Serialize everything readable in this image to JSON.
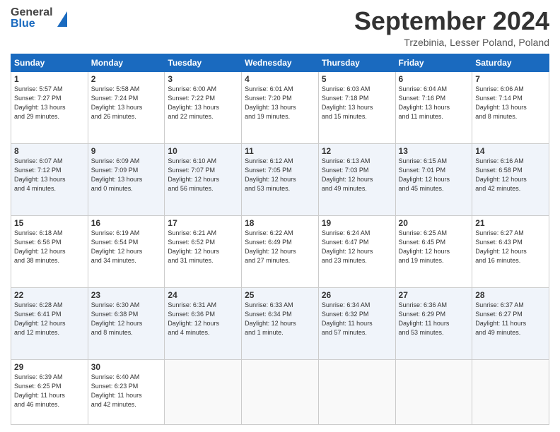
{
  "header": {
    "logo_general": "General",
    "logo_blue": "Blue",
    "month_title": "September 2024",
    "location": "Trzebinia, Lesser Poland, Poland"
  },
  "calendar": {
    "days_of_week": [
      "Sunday",
      "Monday",
      "Tuesday",
      "Wednesday",
      "Thursday",
      "Friday",
      "Saturday"
    ],
    "weeks": [
      [
        {
          "day": "1",
          "info": "Sunrise: 5:57 AM\nSunset: 7:27 PM\nDaylight: 13 hours\nand 29 minutes."
        },
        {
          "day": "2",
          "info": "Sunrise: 5:58 AM\nSunset: 7:24 PM\nDaylight: 13 hours\nand 26 minutes."
        },
        {
          "day": "3",
          "info": "Sunrise: 6:00 AM\nSunset: 7:22 PM\nDaylight: 13 hours\nand 22 minutes."
        },
        {
          "day": "4",
          "info": "Sunrise: 6:01 AM\nSunset: 7:20 PM\nDaylight: 13 hours\nand 19 minutes."
        },
        {
          "day": "5",
          "info": "Sunrise: 6:03 AM\nSunset: 7:18 PM\nDaylight: 13 hours\nand 15 minutes."
        },
        {
          "day": "6",
          "info": "Sunrise: 6:04 AM\nSunset: 7:16 PM\nDaylight: 13 hours\nand 11 minutes."
        },
        {
          "day": "7",
          "info": "Sunrise: 6:06 AM\nSunset: 7:14 PM\nDaylight: 13 hours\nand 8 minutes."
        }
      ],
      [
        {
          "day": "8",
          "info": "Sunrise: 6:07 AM\nSunset: 7:12 PM\nDaylight: 13 hours\nand 4 minutes."
        },
        {
          "day": "9",
          "info": "Sunrise: 6:09 AM\nSunset: 7:09 PM\nDaylight: 13 hours\nand 0 minutes."
        },
        {
          "day": "10",
          "info": "Sunrise: 6:10 AM\nSunset: 7:07 PM\nDaylight: 12 hours\nand 56 minutes."
        },
        {
          "day": "11",
          "info": "Sunrise: 6:12 AM\nSunset: 7:05 PM\nDaylight: 12 hours\nand 53 minutes."
        },
        {
          "day": "12",
          "info": "Sunrise: 6:13 AM\nSunset: 7:03 PM\nDaylight: 12 hours\nand 49 minutes."
        },
        {
          "day": "13",
          "info": "Sunrise: 6:15 AM\nSunset: 7:01 PM\nDaylight: 12 hours\nand 45 minutes."
        },
        {
          "day": "14",
          "info": "Sunrise: 6:16 AM\nSunset: 6:58 PM\nDaylight: 12 hours\nand 42 minutes."
        }
      ],
      [
        {
          "day": "15",
          "info": "Sunrise: 6:18 AM\nSunset: 6:56 PM\nDaylight: 12 hours\nand 38 minutes."
        },
        {
          "day": "16",
          "info": "Sunrise: 6:19 AM\nSunset: 6:54 PM\nDaylight: 12 hours\nand 34 minutes."
        },
        {
          "day": "17",
          "info": "Sunrise: 6:21 AM\nSunset: 6:52 PM\nDaylight: 12 hours\nand 31 minutes."
        },
        {
          "day": "18",
          "info": "Sunrise: 6:22 AM\nSunset: 6:49 PM\nDaylight: 12 hours\nand 27 minutes."
        },
        {
          "day": "19",
          "info": "Sunrise: 6:24 AM\nSunset: 6:47 PM\nDaylight: 12 hours\nand 23 minutes."
        },
        {
          "day": "20",
          "info": "Sunrise: 6:25 AM\nSunset: 6:45 PM\nDaylight: 12 hours\nand 19 minutes."
        },
        {
          "day": "21",
          "info": "Sunrise: 6:27 AM\nSunset: 6:43 PM\nDaylight: 12 hours\nand 16 minutes."
        }
      ],
      [
        {
          "day": "22",
          "info": "Sunrise: 6:28 AM\nSunset: 6:41 PM\nDaylight: 12 hours\nand 12 minutes."
        },
        {
          "day": "23",
          "info": "Sunrise: 6:30 AM\nSunset: 6:38 PM\nDaylight: 12 hours\nand 8 minutes."
        },
        {
          "day": "24",
          "info": "Sunrise: 6:31 AM\nSunset: 6:36 PM\nDaylight: 12 hours\nand 4 minutes."
        },
        {
          "day": "25",
          "info": "Sunrise: 6:33 AM\nSunset: 6:34 PM\nDaylight: 12 hours\nand 1 minute."
        },
        {
          "day": "26",
          "info": "Sunrise: 6:34 AM\nSunset: 6:32 PM\nDaylight: 11 hours\nand 57 minutes."
        },
        {
          "day": "27",
          "info": "Sunrise: 6:36 AM\nSunset: 6:29 PM\nDaylight: 11 hours\nand 53 minutes."
        },
        {
          "day": "28",
          "info": "Sunrise: 6:37 AM\nSunset: 6:27 PM\nDaylight: 11 hours\nand 49 minutes."
        }
      ],
      [
        {
          "day": "29",
          "info": "Sunrise: 6:39 AM\nSunset: 6:25 PM\nDaylight: 11 hours\nand 46 minutes."
        },
        {
          "day": "30",
          "info": "Sunrise: 6:40 AM\nSunset: 6:23 PM\nDaylight: 11 hours\nand 42 minutes."
        },
        {
          "day": "",
          "info": ""
        },
        {
          "day": "",
          "info": ""
        },
        {
          "day": "",
          "info": ""
        },
        {
          "day": "",
          "info": ""
        },
        {
          "day": "",
          "info": ""
        }
      ]
    ]
  }
}
